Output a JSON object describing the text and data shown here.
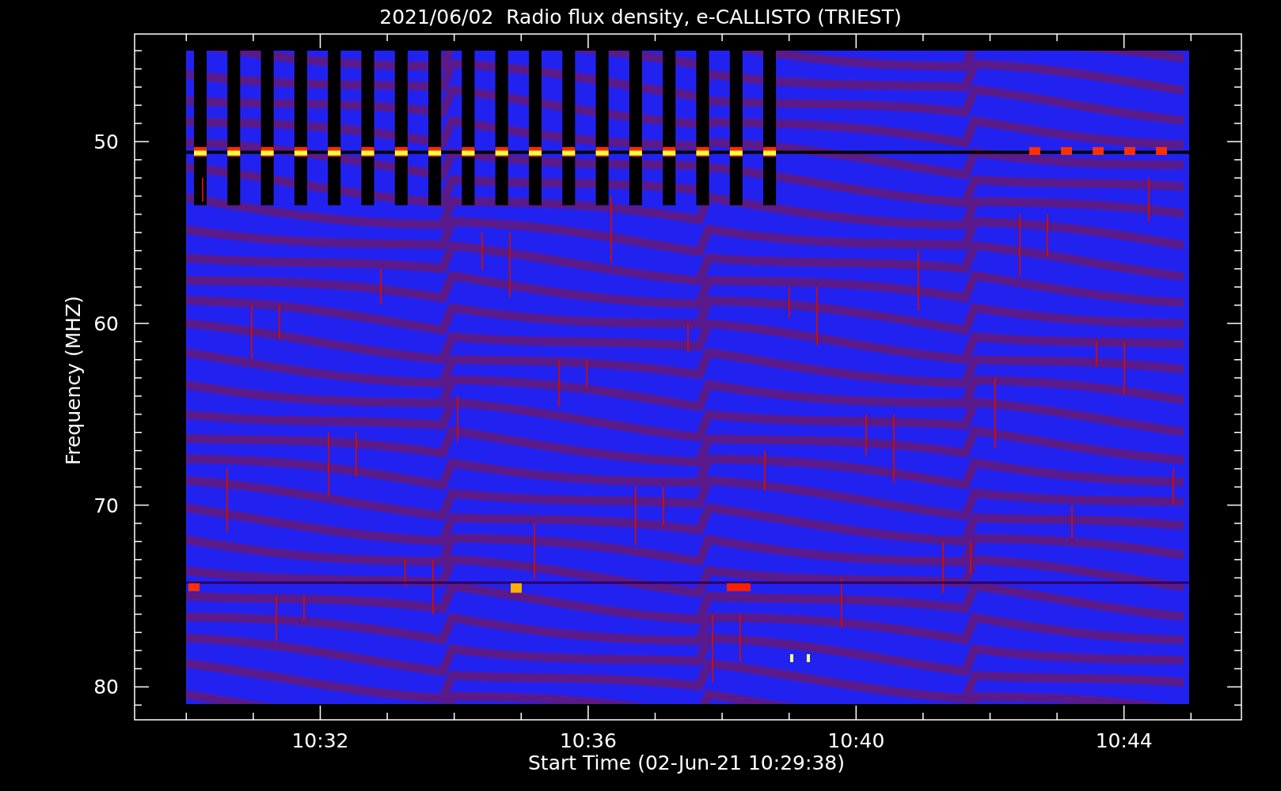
{
  "plot": {
    "title": "2021/06/02  Radio flux density, e-CALLISTO (TRIEST)",
    "ylabel": "Frequency (MHZ)",
    "xlabel": "Start Time (02-Jun-21 10:29:38)",
    "yticks": [
      "50",
      "60",
      "70",
      "80"
    ],
    "xticks": [
      "10:32",
      "10:36",
      "10:40",
      "10:44"
    ]
  }
}
